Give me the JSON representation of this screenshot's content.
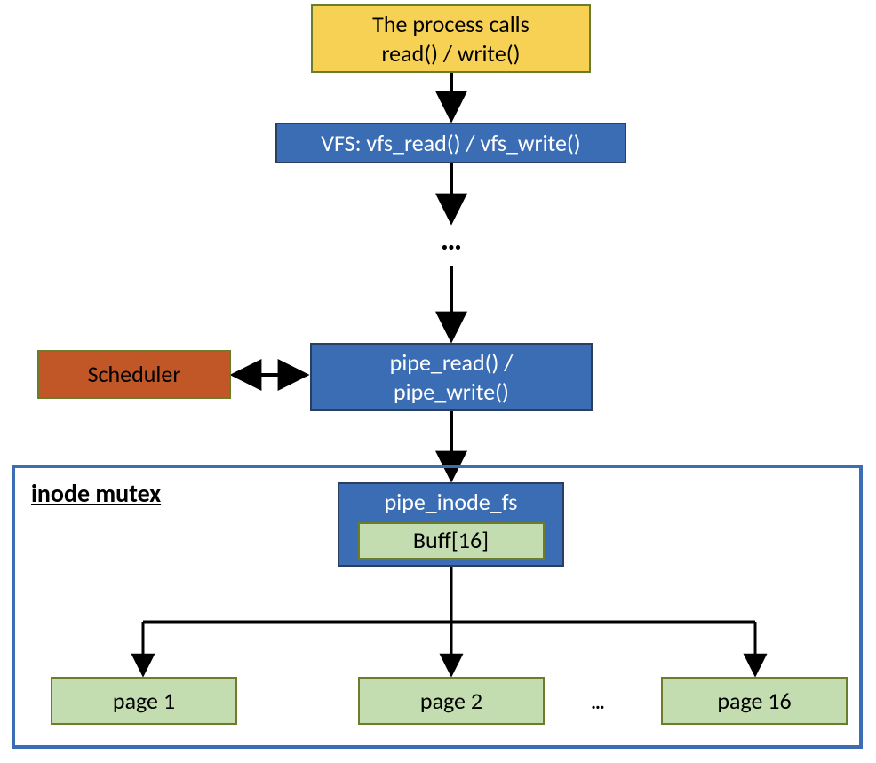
{
  "boxes": {
    "process": {
      "line1": "The process calls",
      "line2": "read() / write()"
    },
    "vfs": "VFS: vfs_read() / vfs_write()",
    "pipe_rw": {
      "line1": "pipe_read() /",
      "line2": "pipe_write()"
    },
    "scheduler": "Scheduler",
    "pipe_inode": "pipe_inode_fs",
    "buff": "Buff[16]",
    "page1": "page 1",
    "page2": "page 2",
    "page16": "page 16"
  },
  "mutex_label": "inode mutex",
  "ellipsis": "…",
  "ellipsis_big": "…"
}
